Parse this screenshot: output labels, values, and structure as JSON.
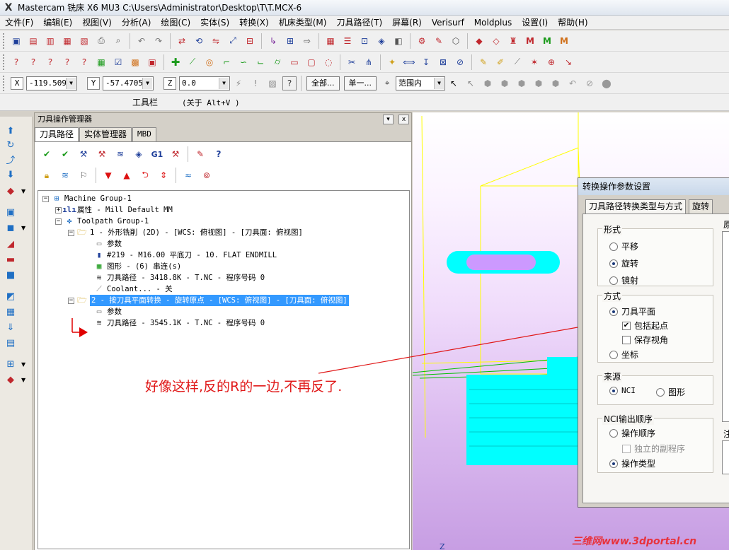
{
  "window": {
    "title": "Mastercam 铣床 X6 MU3  C:\\Users\\Administrator\\Desktop\\T\\T.MCX-6"
  },
  "menu": [
    "文件(F)",
    "编辑(E)",
    "视图(V)",
    "分析(A)",
    "绘图(C)",
    "实体(S)",
    "转换(X)",
    "机床类型(M)",
    "刀具路径(T)",
    "屏幕(R)",
    "Verisurf",
    "Moldplus",
    "设置(I)",
    "帮助(H)"
  ],
  "coords": {
    "x_label": "X",
    "x_value": "-119.5090",
    "y_label": "Y",
    "y_value": "-57.47055",
    "z_label": "Z",
    "z_value": "0.0",
    "btn_all": "全部...",
    "btn_single": "单一...",
    "range_select": "范围内"
  },
  "toolbar_hint": {
    "label": "工具栏",
    "hint": "(关于 Alt+V )"
  },
  "manager": {
    "title": "刀具操作管理器",
    "caption_dropdown": "▾",
    "caption_close": "x",
    "tabs": [
      "刀具路径",
      "实体管理器",
      "MBD"
    ],
    "tree": {
      "machine_group": "Machine Group-1",
      "properties": "属性 - Mill Default MM",
      "toolpath_group": "Toolpath Group-1",
      "op1": "1 - 外形铣削 (2D) - [WCS: 俯视图] - [刀具面: 俯视图]",
      "op1_params": "参数",
      "op1_tool": "#219 - M16.00 平底刀 -    10. FLAT ENDMILL",
      "op1_geometry": "图形 - (6) 串连(s)",
      "op1_toolpath": "刀具路径 - 3418.8K - T.NC - 程序号码 0",
      "op1_coolant": "Coolant... - 关",
      "op2": "2 - 按刀具平面转换 - 旋转原点 - [WCS: 俯视图] - [刀具面: 俯视图]",
      "op2_params": "参数",
      "op2_toolpath": "刀具路径 - 3545.1K - T.NC - 程序号码 0"
    }
  },
  "dialog": {
    "title": "转换操作参数设置",
    "tab_active": "刀具路径转换类型与方式",
    "tab_other": "旋转",
    "right_clip_label": "原",
    "right_clip_label2": "注",
    "group_type": {
      "title": "形式",
      "options": [
        "平移",
        "旋转",
        "镜射"
      ],
      "selected": "旋转"
    },
    "group_method": {
      "title": "方式",
      "options": [
        "刀具平面",
        "坐标"
      ],
      "selected": "刀具平面",
      "check_include_start": "包括起点",
      "check_save_view": "保存视角"
    },
    "group_source": {
      "title": "来源",
      "options": [
        "NCI",
        "图形"
      ],
      "selected": "NCI"
    },
    "group_nci_order": {
      "title": "NCI输出顺序",
      "options": [
        "操作顺序",
        "操作类型"
      ],
      "selected": "操作类型",
      "check_independent": "独立的副程序"
    }
  },
  "annotation": {
    "text": "好像这样,反的R的一边,不再反了.",
    "color": "#e01818"
  },
  "viewport": {
    "axis_label": "Z"
  },
  "watermark": "三维网www.3dportal.cn",
  "colors": {
    "selection": "#3399ff",
    "toolpath_cyan": "#00ffff",
    "wireframe_yellow": "#ffff00",
    "green_path": "#00c000",
    "annotation_red": "#e01818"
  }
}
